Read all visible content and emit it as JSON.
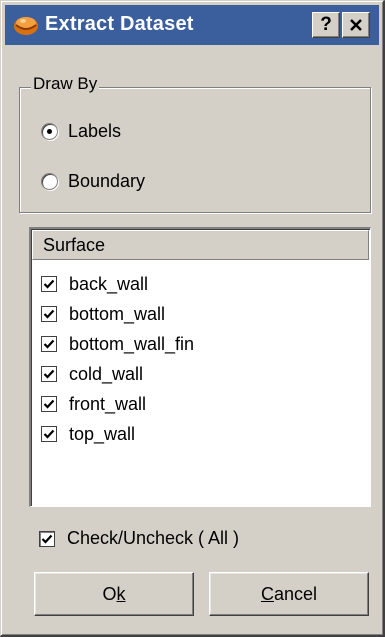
{
  "window": {
    "title": "Extract Dataset",
    "help_label": "?",
    "close_label": "✕"
  },
  "draw_by": {
    "legend": "Draw By",
    "options": [
      {
        "label": "Labels",
        "selected": true
      },
      {
        "label": "Boundary",
        "selected": false
      }
    ]
  },
  "surface_list": {
    "header": "Surface",
    "items": [
      {
        "label": "back_wall",
        "checked": true
      },
      {
        "label": "bottom_wall",
        "checked": true
      },
      {
        "label": "bottom_wall_fin",
        "checked": true
      },
      {
        "label": "cold_wall",
        "checked": true
      },
      {
        "label": "front_wall",
        "checked": true
      },
      {
        "label": "top_wall",
        "checked": true
      }
    ]
  },
  "check_all": {
    "label": "Check/Uncheck ( All )",
    "checked": true
  },
  "buttons": {
    "ok": {
      "prefix": "O",
      "mnemonic": "k",
      "suffix": ""
    },
    "cancel": {
      "prefix": "",
      "mnemonic": "C",
      "suffix": "ancel"
    }
  },
  "colors": {
    "titlebar": "#3b5e9c",
    "face": "#d4d0c8"
  },
  "icons": {
    "app": "orange-globe-icon",
    "help": "question-mark-icon",
    "close": "close-icon"
  }
}
